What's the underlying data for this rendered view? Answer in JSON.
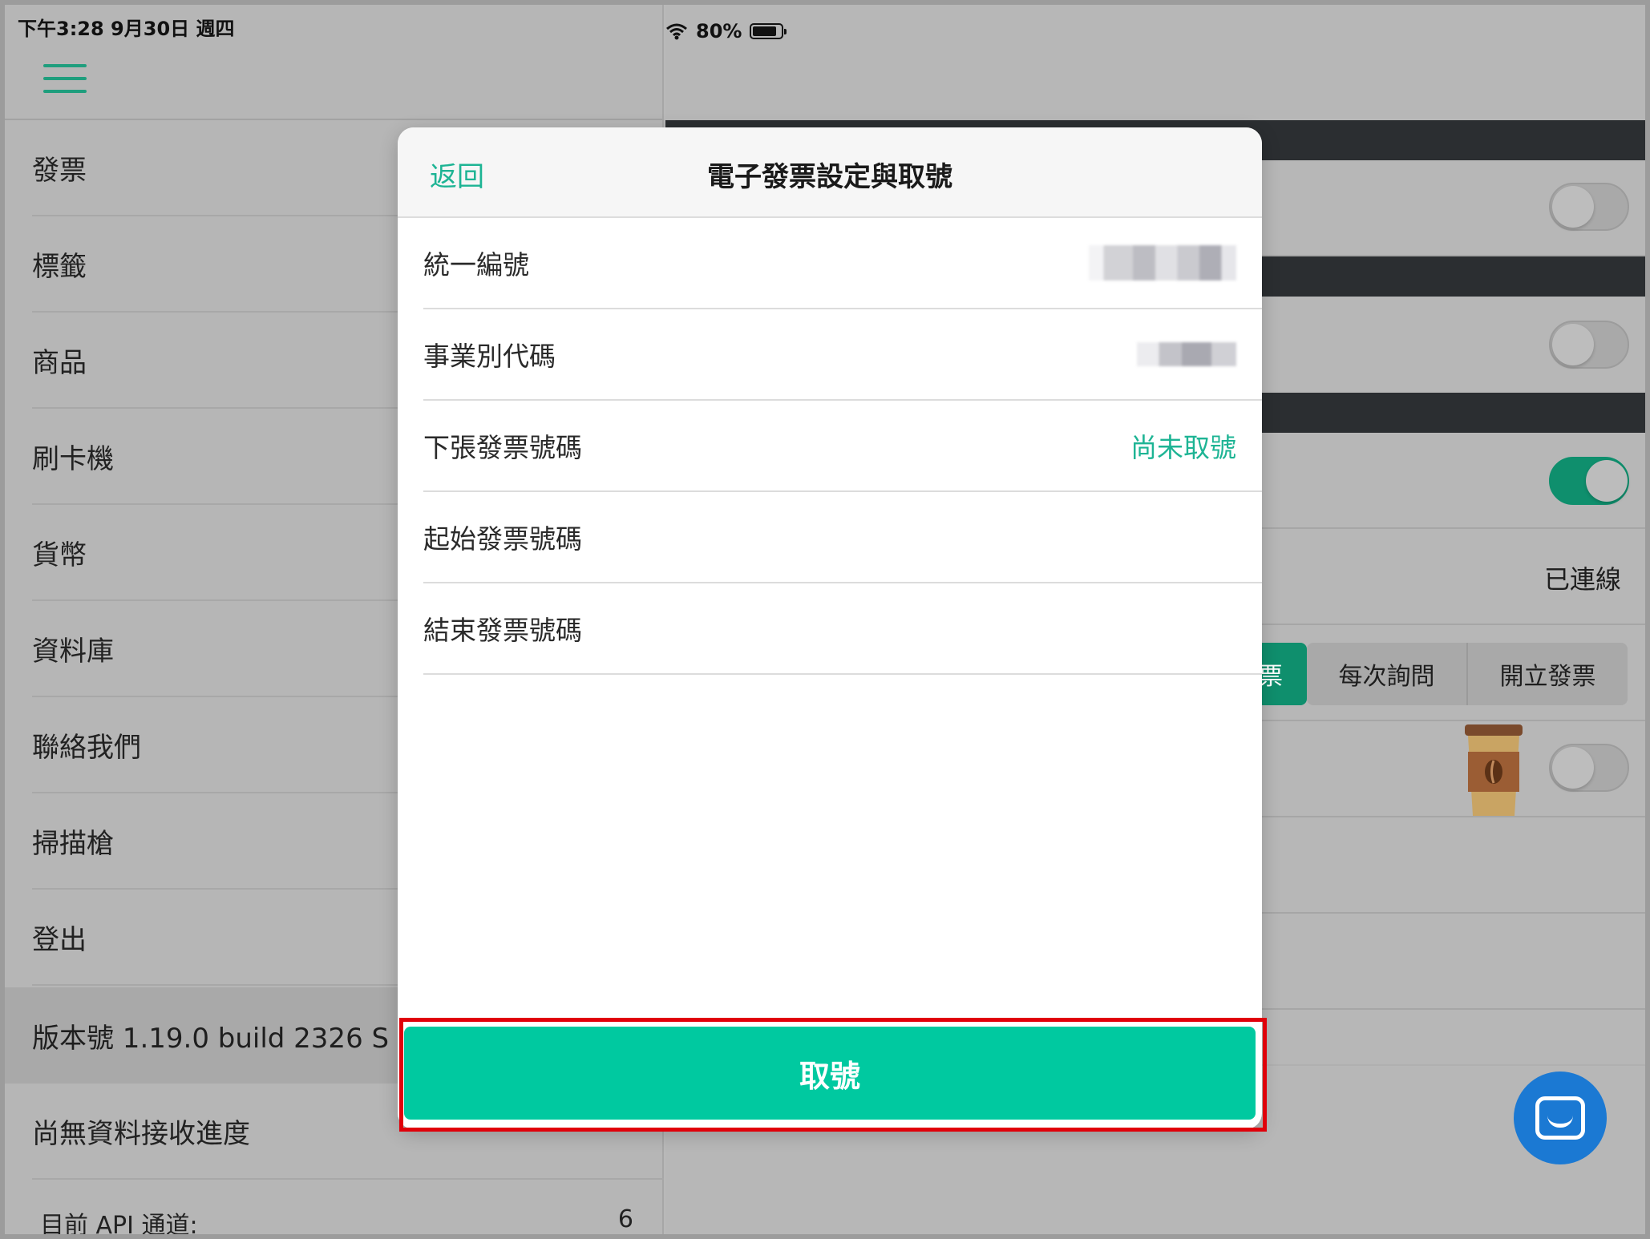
{
  "status_bar": {
    "time_date": "下午3:28   9月30日 週四",
    "battery": "80%"
  },
  "sidebar": {
    "items": [
      {
        "label": "發票"
      },
      {
        "label": "標籤"
      },
      {
        "label": "商品"
      },
      {
        "label": "刷卡機"
      },
      {
        "label": "貨幣"
      },
      {
        "label": "資料庫"
      },
      {
        "label": "聯絡我們"
      },
      {
        "label": "掃描槍"
      },
      {
        "label": "登出"
      }
    ],
    "version": "版本號 1.19.0   build 2326    S",
    "progress": "尚無資料接收進度",
    "api_label": "目前 API 通道:",
    "api_value": "6"
  },
  "background_panel": {
    "connected_status": "已連線",
    "segments": [
      "每次詢問",
      "開立發票"
    ],
    "segment_partial": "票"
  },
  "modal": {
    "back": "返回",
    "title": "電子發票設定與取號",
    "fields": [
      {
        "label": "統一編號",
        "value": ""
      },
      {
        "label": "事業別代碼",
        "value": ""
      },
      {
        "label": "下張發票號碼",
        "value": "尚未取號"
      },
      {
        "label": "起始發票號碼",
        "value": ""
      },
      {
        "label": "結束發票號碼",
        "value": ""
      }
    ],
    "take_number_button": "取號"
  },
  "colors": {
    "accent": "#00c9a0",
    "accent_text": "#1db494",
    "highlight": "#e0000a",
    "chat_button": "#1b79d3"
  }
}
